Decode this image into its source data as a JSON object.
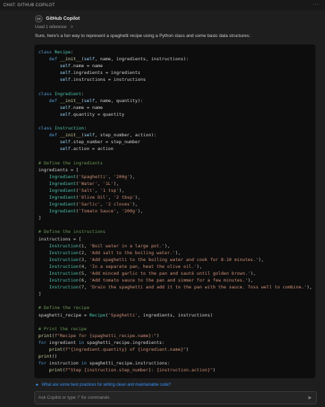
{
  "panel": {
    "title": "CHAT: GITHUB COPILOT",
    "more_icon": "ellipsis-icon"
  },
  "message": {
    "author": "GitHub Copilot",
    "used_reference": "Used 1 reference",
    "intro": "Sure, here's a fun way to represent a spaghetti recipe using a Python class and some basic data structures:"
  },
  "code": {
    "language": "python",
    "lines": [
      "class Recipe:",
      "    def __init__(self, name, ingredients, instructions):",
      "        self.name = name",
      "        self.ingredients = ingredients",
      "        self.instructions = instructions",
      "",
      "class Ingredient:",
      "    def __init__(self, name, quantity):",
      "        self.name = name",
      "        self.quantity = quantity",
      "",
      "class Instruction:",
      "    def __init__(self, step_number, action):",
      "        self.step_number = step_number",
      "        self.action = action",
      "",
      "# Define the ingredients",
      "ingredients = [",
      "    Ingredient('Spaghetti', '200g'),",
      "    Ingredient('Water', '1L'),",
      "    Ingredient('Salt', '1 tsp'),",
      "    Ingredient('Olive Oil', '2 tbsp'),",
      "    Ingredient('Garlic', '2 cloves'),",
      "    Ingredient('Tomato Sauce', '200g'),",
      "]",
      "",
      "# Define the instructions",
      "instructions = [",
      "    Instruction(1, 'Boil water in a large pot.'),",
      "    Instruction(2, 'Add salt to the boiling water.'),",
      "    Instruction(3, 'Add spaghetti to the boiling water and cook for 8-10 minutes.'),",
      "    Instruction(4, 'In a separate pan, heat the olive oil.'),",
      "    Instruction(5, 'Add minced garlic to the pan and sauté until golden brown.'),",
      "    Instruction(6, 'Add tomato sauce to the pan and simmer for a few minutes.'),",
      "    Instruction(7, 'Drain the spaghetti and add it to the pan with the sauce. Toss well to combine.'),",
      "]",
      "",
      "# Define the recipe",
      "spaghetti_recipe = Recipe('Spaghetti', ingredients, instructions)",
      "",
      "# Print the recipe",
      "print(f\"Recipe for {spaghetti_recipe.name}:\")",
      "for ingredient in spaghetti_recipe.ingredients:",
      "    print(f\"{ingredient.quantity} of {ingredient.name}\")",
      "print()",
      "for instruction in spaghetti_recipe.instructions:",
      "    print(f\"Step {instruction.step_number}: {instruction.action}\")"
    ]
  },
  "suggestion": {
    "text": "What are some best practices for writing clean and maintainable code?",
    "icon": "sparkle-icon"
  },
  "input": {
    "placeholder": "Ask Copilot or type '/' for commands",
    "value": "",
    "send_icon": "send-icon"
  },
  "colors": {
    "background": "#1e1e1e",
    "code_background": "#0d0d0d",
    "keyword": "#569cd6",
    "function": "#dcdcaa",
    "class": "#4ec9b0",
    "string": "#ce9178",
    "comment": "#6a9955",
    "link": "#3794ff"
  }
}
